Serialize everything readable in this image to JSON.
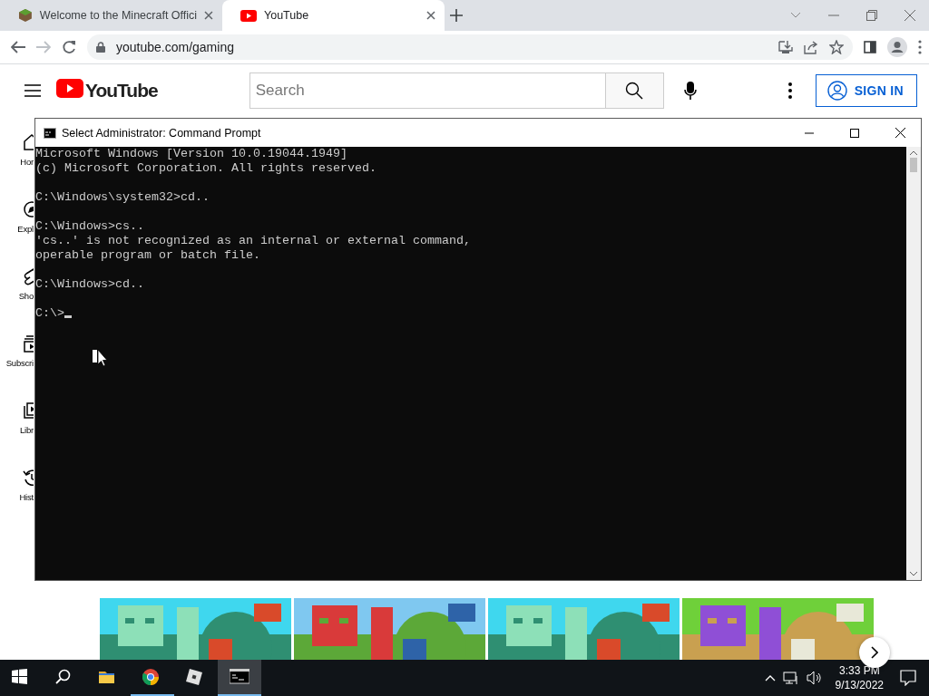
{
  "browser": {
    "tabs": [
      {
        "title": "Welcome to the Minecraft Offici",
        "selected": false
      },
      {
        "title": "YouTube",
        "selected": true
      }
    ],
    "address": "youtube.com/gaming"
  },
  "youtube": {
    "logo": "YouTube",
    "search": {
      "placeholder": "Search"
    },
    "sign_in": "SIGN IN",
    "sidebar": [
      {
        "label": "Hor",
        "kind": "home"
      },
      {
        "label": "Expl",
        "kind": "explore"
      },
      {
        "label": "Sho",
        "kind": "shorts"
      },
      {
        "label": "Subscri",
        "kind": "subscriptions"
      },
      {
        "label": "Libr",
        "kind": "library"
      },
      {
        "label": "Hist",
        "kind": "history"
      }
    ]
  },
  "cmd": {
    "title": "Select Administrator: Command Prompt",
    "blocks": [
      {
        "lines": [
          "Microsoft Windows [Version 10.0.19044.1949]",
          "(c) Microsoft Corporation. All rights reserved."
        ]
      },
      {
        "lines": [
          "C:\\Windows\\system32>cd.."
        ]
      },
      {
        "lines": [
          "C:\\Windows>cs..",
          "'cs..' is not recognized as an internal or external command,",
          "operable program or batch file."
        ]
      },
      {
        "lines": [
          "C:\\Windows>cd.."
        ]
      },
      {
        "lines": [
          "C:\\>"
        ]
      }
    ]
  },
  "taskbar": {
    "apps": [
      {
        "kind": "start",
        "running": false,
        "selected": false
      },
      {
        "kind": "search",
        "running": false,
        "selected": false
      },
      {
        "kind": "explorer",
        "running": false,
        "selected": false
      },
      {
        "kind": "chrome",
        "running": true,
        "selected": false
      },
      {
        "kind": "roblox",
        "running": false,
        "selected": false
      },
      {
        "kind": "cmd",
        "running": true,
        "selected": true
      }
    ],
    "time": "3:33 PM",
    "date": "9/13/2022"
  }
}
